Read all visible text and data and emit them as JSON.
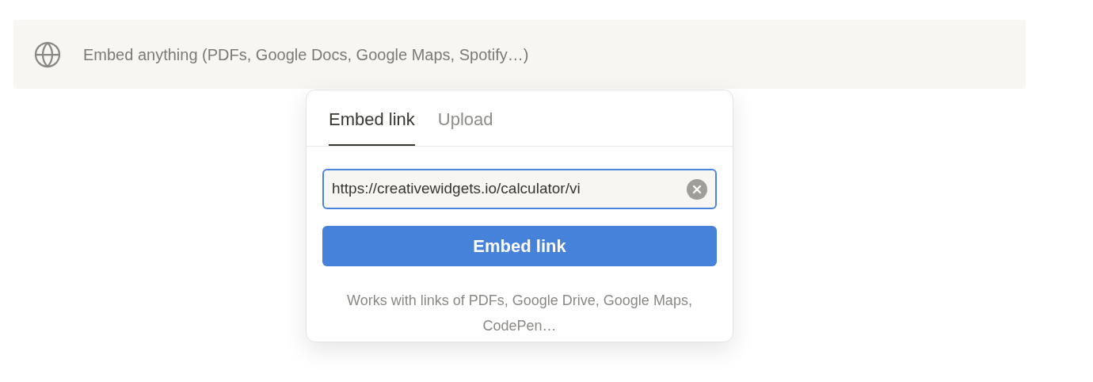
{
  "embed_bar": {
    "label": "Embed anything (PDFs, Google Docs, Google Maps, Spotify…)"
  },
  "popup": {
    "tabs": [
      {
        "label": "Embed link",
        "selected": true
      },
      {
        "label": "Upload",
        "selected": false
      }
    ],
    "url_field": {
      "value": "https://creativewidgets.io/calculator/vi"
    },
    "submit_button": "Embed link",
    "hint": "Works with links of PDFs, Google Drive, Google Maps, CodePen…"
  }
}
